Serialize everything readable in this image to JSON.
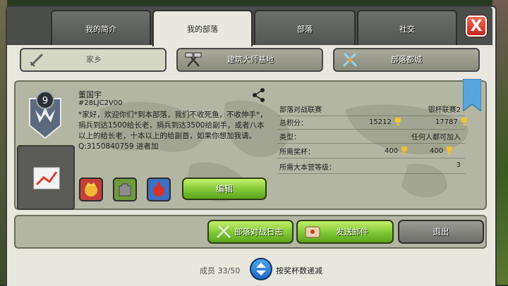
{
  "tabs": [
    {
      "label": "我的简介",
      "active": false
    },
    {
      "label": "我的部落",
      "active": true
    },
    {
      "label": "部落",
      "active": false
    },
    {
      "label": "社交",
      "active": false
    }
  ],
  "close_icon": "X",
  "subtabs": [
    {
      "label": "家乡",
      "icon": "sword-icon",
      "active": true
    },
    {
      "label": "建筑大师基地",
      "icon": "crossed-hammers-icon",
      "active": false
    },
    {
      "label": "部落都城",
      "icon": "crossed-swords-icon",
      "active": false
    }
  ],
  "clan": {
    "level": "9",
    "name": "董国宇",
    "tag": "#28LJC2V00",
    "description": "*家好，欢迎你们*到本部落，我们不收死鱼，不收伸手*，捐兵到达1500给长老，捐兵到达3500给副手，或者八本以上的给长老，十本以上的给副首，如果你想加我请。Q:3150840759 进者加"
  },
  "stats": {
    "war_league_label": "部落对战联赛",
    "war_league_value": "银杯联赛2",
    "total_points_label": "总积分：",
    "total_points_home": "15212",
    "total_points_builder": "17787",
    "type_label": "类型：",
    "type_value": "任何人都可加入",
    "required_trophies_label": "所需奖杯：",
    "required_trophies_home": "400",
    "required_trophies_builder": "400",
    "required_th_label": "所需大本营等级：",
    "required_th_value": "3"
  },
  "buttons": {
    "edit": "编辑",
    "war_log": "部落对战日志",
    "send_mail": "发送邮件",
    "leave": "退出"
  },
  "members": "成员 33/50",
  "sort_label": "按奖杯数递减",
  "colors": {
    "green_button": "#7ec733",
    "close_red": "#d93a2b",
    "trophy_gold": "#f2c12e",
    "ribbon_blue": "#5aa6dc"
  }
}
